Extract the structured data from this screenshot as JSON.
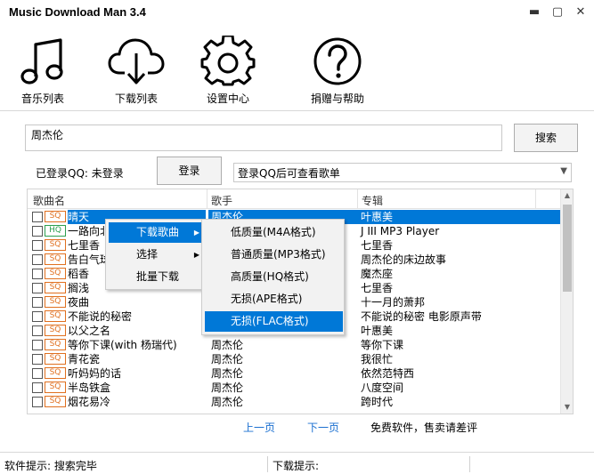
{
  "window": {
    "title": "Music Download Man 3.4",
    "minimize": "▬",
    "maximize": "▢",
    "close": "✕"
  },
  "toolbar": [
    {
      "label": "音乐列表",
      "icon": "music-note-icon"
    },
    {
      "label": "下载列表",
      "icon": "cloud-download-icon"
    },
    {
      "label": "设置中心",
      "icon": "gear-icon"
    },
    {
      "label": "捐赠与帮助",
      "icon": "question-icon"
    }
  ],
  "search": {
    "value": "周杰伦",
    "button_label": "搜索"
  },
  "login": {
    "status_text": "已登录QQ: 未登录",
    "button_label": "登录",
    "playlist_select": "登录QQ后可查看歌单"
  },
  "song_list": {
    "columns": [
      "歌曲名",
      "歌手",
      "专辑"
    ],
    "rows": [
      {
        "badge": "SQ",
        "name": "晴天",
        "singer": "周杰伦",
        "album": "叶惠美",
        "selected": true
      },
      {
        "badge": "HQ",
        "name": "一路向北",
        "singer": "",
        "album": "J III MP3 Player"
      },
      {
        "badge": "SQ",
        "name": "七里香",
        "singer": "",
        "album": "七里香"
      },
      {
        "badge": "SQ",
        "name": "告白气球",
        "singer": "",
        "album": "周杰伦的床边故事"
      },
      {
        "badge": "SQ",
        "name": "稻香",
        "singer": "",
        "album": "魔杰座"
      },
      {
        "badge": "SQ",
        "name": "搁浅",
        "singer": "",
        "album": "七里香"
      },
      {
        "badge": "SQ",
        "name": "夜曲",
        "singer": "",
        "album": "十一月的萧邦"
      },
      {
        "badge": "SQ",
        "name": "不能说的秘密",
        "singer": "",
        "album": "不能说的秘密 电影原声带"
      },
      {
        "badge": "SQ",
        "name": "以父之名",
        "singer": "",
        "album": "叶惠美"
      },
      {
        "badge": "SQ",
        "name": "等你下课(with 杨瑞代)",
        "singer": "周杰伦",
        "album": "等你下课"
      },
      {
        "badge": "SQ",
        "name": "青花瓷",
        "singer": "周杰伦",
        "album": "我很忙"
      },
      {
        "badge": "SQ",
        "name": "听妈妈的话",
        "singer": "周杰伦",
        "album": "依然范特西"
      },
      {
        "badge": "SQ",
        "name": "半岛铁盒",
        "singer": "周杰伦",
        "album": "八度空间"
      },
      {
        "badge": "SQ",
        "name": "烟花易冷",
        "singer": "周杰伦",
        "album": "跨时代"
      }
    ]
  },
  "context_menu": {
    "items": [
      {
        "label": "下载歌曲",
        "has_submenu": true,
        "active": true
      },
      {
        "label": "选择",
        "has_submenu": true
      },
      {
        "label": "批量下载",
        "has_submenu": false
      }
    ]
  },
  "download_submenu": {
    "items": [
      {
        "label": "低质量(M4A格式)"
      },
      {
        "label": "普通质量(MP3格式)"
      },
      {
        "label": "高质量(HQ格式)"
      },
      {
        "label": "无损(APE格式)"
      },
      {
        "label": "无损(FLAC格式)",
        "active": true
      }
    ]
  },
  "pager": {
    "prev": "上一页",
    "next": "下一页",
    "notice": "免费软件，售卖请差评"
  },
  "status": {
    "software_hint": "软件提示: 搜索完毕",
    "download_hint": "下载提示:"
  },
  "colors": {
    "selection": "#0078d7",
    "sq_badge": "#e07020",
    "hq_badge": "#2ca050",
    "link": "#1a6fd0"
  }
}
